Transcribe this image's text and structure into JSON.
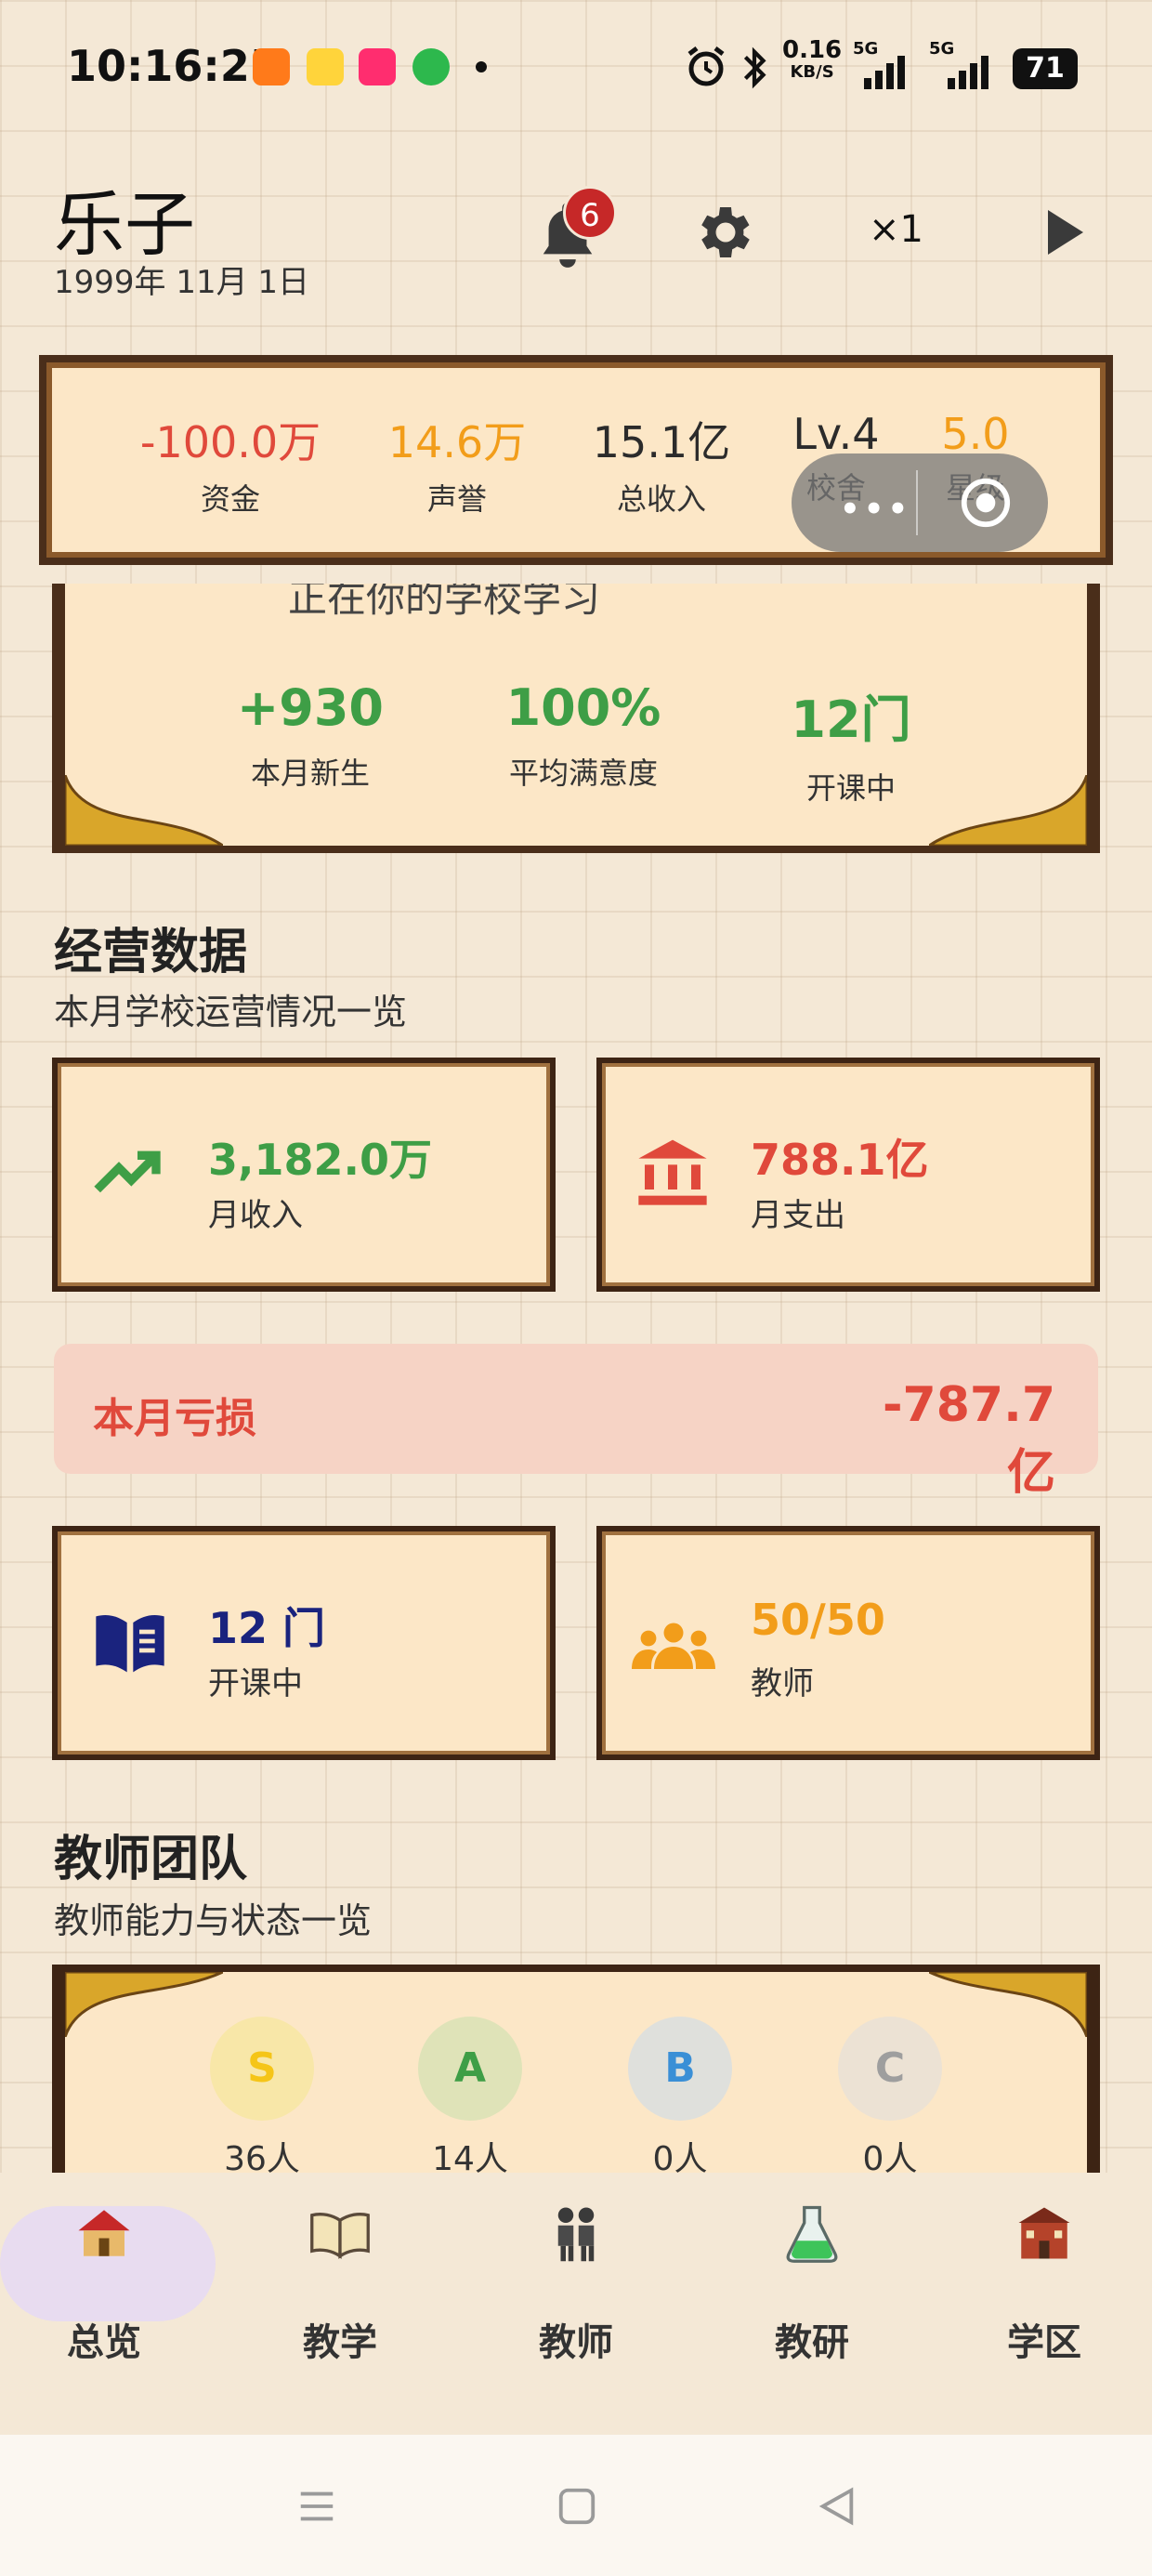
{
  "status_bar": {
    "time": "10:16:25",
    "network_speed": "0.16",
    "network_unit": "KB/S",
    "signal_1": "5G",
    "signal_2": "5G",
    "battery": "71"
  },
  "header": {
    "player_name": "乐子",
    "date": "1999年 11月 1日",
    "notification_count": "6",
    "speed": "×1"
  },
  "stats_bar": [
    {
      "value": "-100.0万",
      "label": "资金",
      "color": "#e0493b"
    },
    {
      "value": "14.6万",
      "label": "声誉",
      "color": "#f29d1a"
    },
    {
      "value": "15.1亿",
      "label": "总收入",
      "color": "#2b2b2b"
    },
    {
      "value": "Lv.4",
      "label": "校舍",
      "color": "#2b2b2b"
    },
    {
      "value": "5.0",
      "label": "星级",
      "color": "#f29d1a"
    }
  ],
  "info_panel": {
    "partial_text": "正在你的学校学习",
    "stats": [
      {
        "value": "+930",
        "label": "本月新生"
      },
      {
        "value": "100%",
        "label": "平均满意度"
      },
      {
        "value": "12门",
        "label": "开课中"
      }
    ]
  },
  "operations": {
    "title": "经营数据",
    "subtitle": "本月学校运营情况一览",
    "income": {
      "value": "3,182.0万",
      "label": "月收入",
      "color": "#3e9e46",
      "icon": "trending-up-icon"
    },
    "expense": {
      "value": "788.1亿",
      "label": "月支出",
      "color": "#e0493b",
      "icon": "bank-icon"
    },
    "loss": {
      "label": "本月亏损",
      "value": "-787.7亿"
    },
    "courses": {
      "value": "12 门",
      "label": "开课中",
      "color": "#1a237e",
      "icon": "book-icon"
    },
    "teachers": {
      "value": "50/50",
      "label": "教师",
      "color": "#f29d1a",
      "icon": "group-icon"
    }
  },
  "teacher_team": {
    "title": "教师团队",
    "subtitle": "教师能力与状态一览",
    "grades": [
      {
        "grade": "S",
        "count": "36人",
        "color": "#f5c518",
        "bg": "#f8e7a8"
      },
      {
        "grade": "A",
        "count": "14人",
        "color": "#3e9e46",
        "bg": "#dfe3b8"
      },
      {
        "grade": "B",
        "count": "0人",
        "color": "#3a8fd6",
        "bg": "#dfe0dc"
      },
      {
        "grade": "C",
        "count": "0人",
        "color": "#9e9e9e",
        "bg": "#ece2d4"
      }
    ]
  },
  "bottom_nav": [
    {
      "label": "总览",
      "icon": "house-icon",
      "active": true
    },
    {
      "label": "教学",
      "icon": "open-book-icon",
      "active": false
    },
    {
      "label": "教师",
      "icon": "people-icon",
      "active": false
    },
    {
      "label": "教研",
      "icon": "flask-icon",
      "active": false
    },
    {
      "label": "学区",
      "icon": "school-building-icon",
      "active": false
    }
  ]
}
